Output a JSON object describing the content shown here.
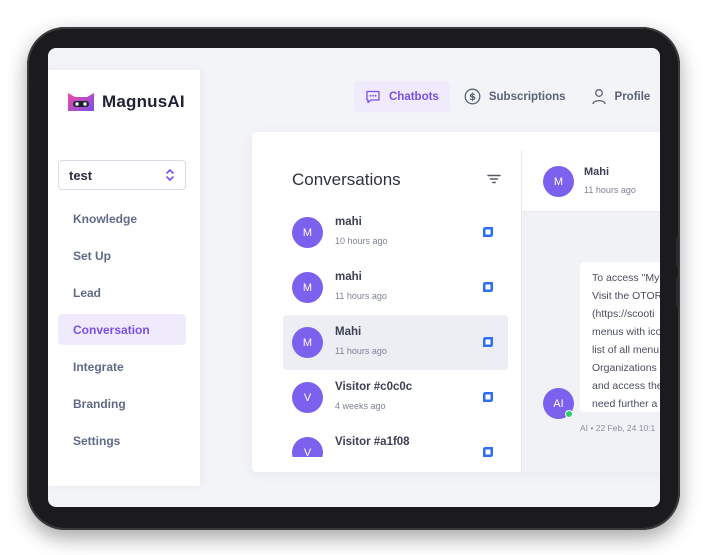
{
  "app": {
    "name": "MagnusAI"
  },
  "sidebar": {
    "project": "test",
    "items": [
      {
        "label": "Knowledge"
      },
      {
        "label": "Set Up"
      },
      {
        "label": "Lead"
      },
      {
        "label": "Conversation"
      },
      {
        "label": "Integrate"
      },
      {
        "label": "Branding"
      },
      {
        "label": "Settings"
      }
    ],
    "active_item": "Conversation"
  },
  "topnav": {
    "items": [
      {
        "label": "Chatbots",
        "icon": "chat-icon"
      },
      {
        "label": "Subscriptions",
        "icon": "dollar-circle-icon"
      },
      {
        "label": "Profile",
        "icon": "user-icon"
      }
    ],
    "active_item": "Chatbots"
  },
  "conversations": {
    "title": "Conversations",
    "items": [
      {
        "initial": "M",
        "name": "mahi",
        "time": "10 hours ago"
      },
      {
        "initial": "M",
        "name": "mahi",
        "time": "11 hours ago"
      },
      {
        "initial": "M",
        "name": "Mahi",
        "time": "11 hours ago"
      },
      {
        "initial": "V",
        "name": "Visitor #c0c0c",
        "time": "4 weeks ago"
      },
      {
        "initial": "V",
        "name": "Visitor #a1f08",
        "time": ""
      }
    ],
    "selected_index": 2
  },
  "chat": {
    "initial": "M",
    "name": "Mahi",
    "time": "11 hours ago",
    "bot_initial": "AI",
    "message_lines": [
      "To access \"My",
      "Visit the OTOR",
      "(https://scooti",
      "menus with ico",
      "list of all menu",
      "Organizations",
      "and access the",
      "need further a"
    ],
    "meta": "AI • 22 Feb, 24 10:1"
  },
  "colors": {
    "accent": "#7b4fe8",
    "accent_bg": "#efeafc",
    "avatar": "#7b61ee",
    "online": "#2ecc71",
    "frame": "#1b1b1d"
  }
}
